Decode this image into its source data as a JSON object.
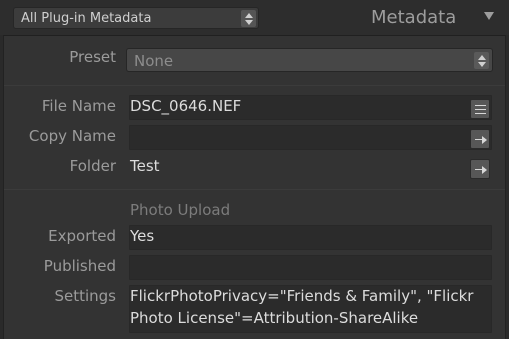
{
  "header": {
    "view_mode": "All Plug-in Metadata",
    "panel_title": "Metadata"
  },
  "preset": {
    "label": "Preset",
    "value": "None"
  },
  "file_info": {
    "file_name_label": "File Name",
    "file_name_value": "DSC_0646.NEF",
    "copy_name_label": "Copy Name",
    "copy_name_value": "",
    "folder_label": "Folder",
    "folder_value": "Test"
  },
  "photo_upload": {
    "section_title": "Photo Upload",
    "exported_label": "Exported",
    "exported_value": "Yes",
    "published_label": "Published",
    "published_value": "",
    "settings_label": "Settings",
    "settings_line1": "FlickrPhotoPrivacy=\"Friends & Family\",  \"Flickr",
    "settings_line2": "Photo License\"=Attribution-ShareAlike"
  },
  "icons": {
    "view_stepper": "up-down-stepper-icon",
    "collapse": "collapse-triangle-icon",
    "file_name_action": "list-icon",
    "copy_name_action": "go-arrow-icon",
    "folder_action": "go-arrow-icon"
  }
}
